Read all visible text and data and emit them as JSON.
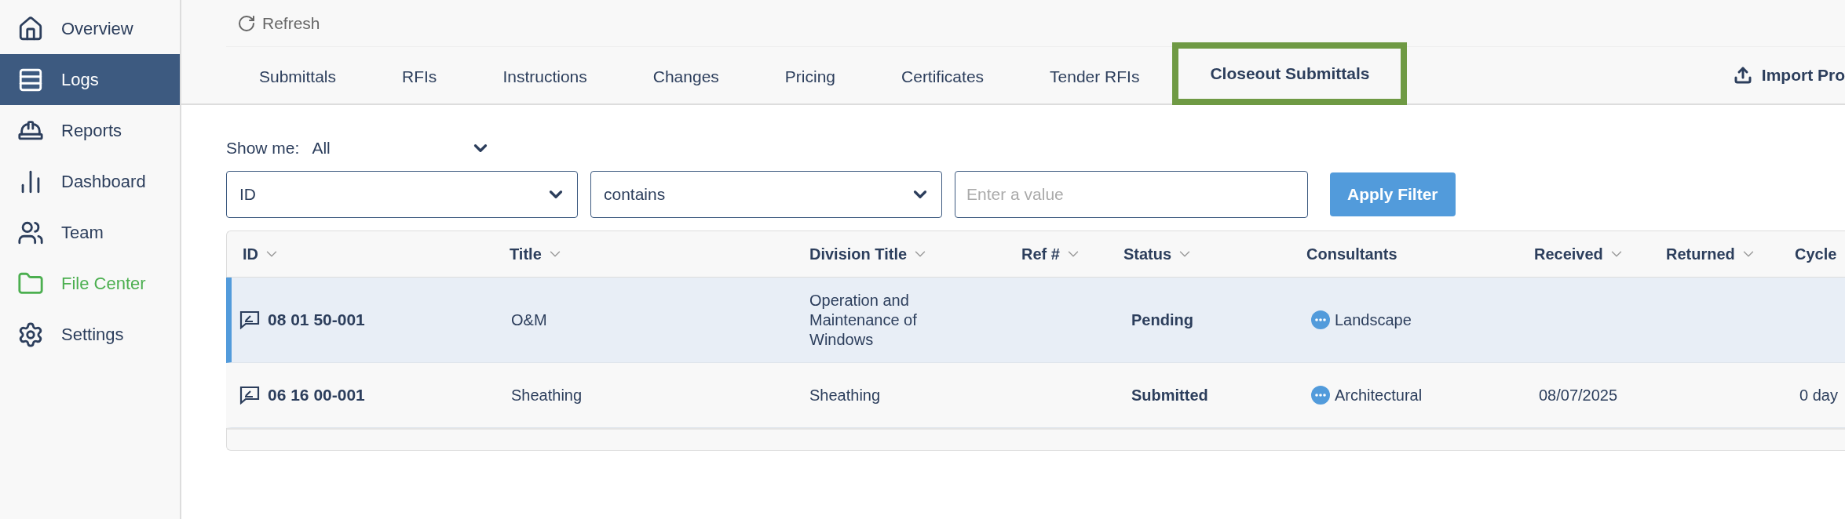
{
  "sidebar": {
    "items": [
      {
        "label": "Overview",
        "selected": false,
        "highlighted": false
      },
      {
        "label": "Logs",
        "selected": true,
        "highlighted": false
      },
      {
        "label": "Reports",
        "selected": false,
        "highlighted": false
      },
      {
        "label": "Dashboard",
        "selected": false,
        "highlighted": false
      },
      {
        "label": "Team",
        "selected": false,
        "highlighted": false
      },
      {
        "label": "File Center",
        "selected": false,
        "highlighted": true
      },
      {
        "label": "Settings",
        "selected": false,
        "highlighted": false
      }
    ]
  },
  "toolbar": {
    "refresh": "Refresh"
  },
  "tabs": [
    {
      "label": "Submittals",
      "selected": false
    },
    {
      "label": "RFIs",
      "selected": false
    },
    {
      "label": "Instructions",
      "selected": false
    },
    {
      "label": "Changes",
      "selected": false
    },
    {
      "label": "Pricing",
      "selected": false
    },
    {
      "label": "Certificates",
      "selected": false
    },
    {
      "label": "Tender RFIs",
      "selected": false
    },
    {
      "label": "Closeout Submittals",
      "selected": true
    }
  ],
  "import_button": "Import Pro",
  "filter": {
    "show_me_label": "Show me:",
    "show_me_value": "All",
    "field": "ID",
    "operator": "contains",
    "placeholder": "Enter a value",
    "apply": "Apply Filter"
  },
  "table": {
    "columns": [
      {
        "label": "ID",
        "sortable": true
      },
      {
        "label": "Title",
        "sortable": true
      },
      {
        "label": "Division Title",
        "sortable": true
      },
      {
        "label": "Ref #",
        "sortable": true
      },
      {
        "label": "Status",
        "sortable": true
      },
      {
        "label": "Consultants",
        "sortable": false
      },
      {
        "label": "Received",
        "sortable": true
      },
      {
        "label": "Returned",
        "sortable": true
      },
      {
        "label": "Cycle"
      }
    ],
    "rows": [
      {
        "selected": true,
        "id": "08 01 50-001",
        "title": "O&M",
        "division_title": "Operation and Maintenance of Windows",
        "status": "Pending",
        "consultant": "Landscape"
      },
      {
        "selected": false,
        "id": "06 16 00-001",
        "title": "Sheathing",
        "division_title": "Sheathing",
        "status": "Submitted",
        "consultant": "Architectural",
        "received": "08/07/2025",
        "cycle": "0 day"
      }
    ]
  }
}
